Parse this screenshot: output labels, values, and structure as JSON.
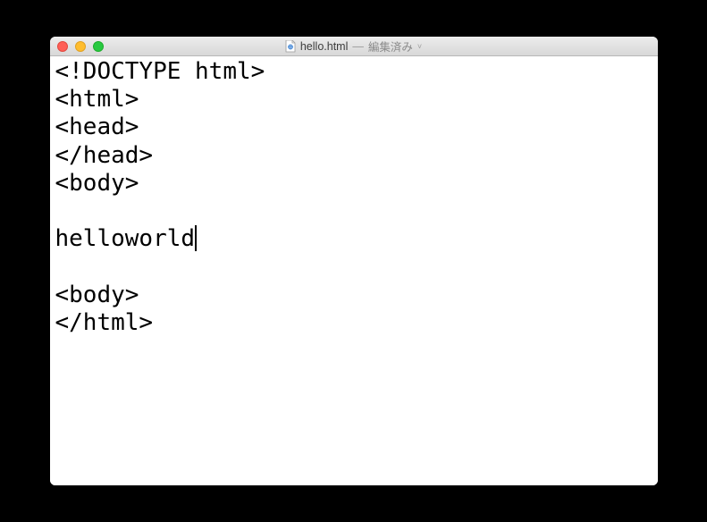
{
  "window": {
    "filename": "hello.html",
    "status": "編集済み",
    "separator": "—"
  },
  "editor": {
    "lines": [
      "<!DOCTYPE html>",
      "<html>",
      "<head>",
      "</head>",
      "<body>",
      "",
      "helloworld",
      "",
      "<body>",
      "</html>"
    ],
    "cursor_line": 6
  }
}
